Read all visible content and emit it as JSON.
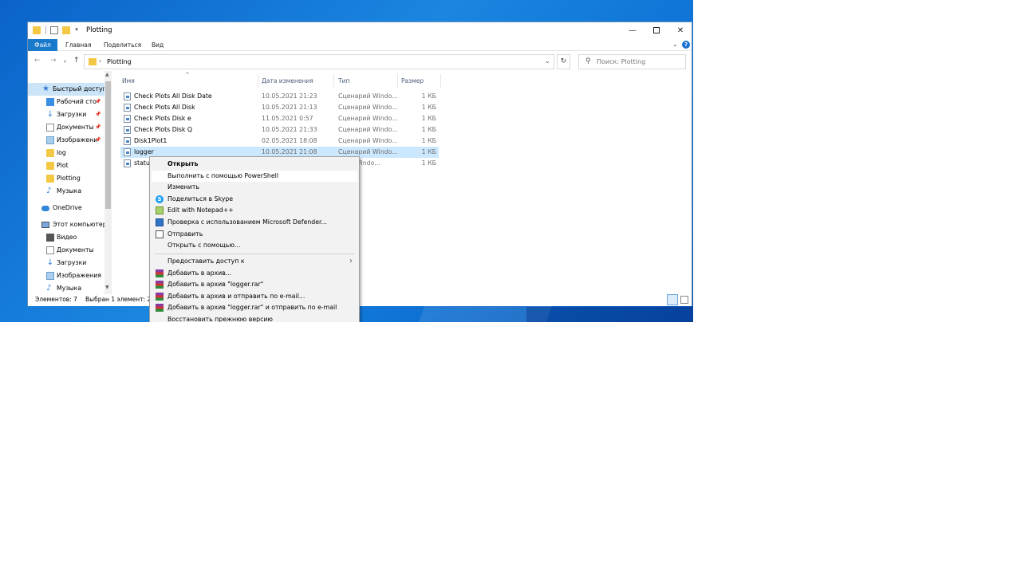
{
  "window": {
    "title": "Plotting",
    "minimize": "—",
    "close": "✕"
  },
  "ribbon": {
    "file": "Файл",
    "home": "Главная",
    "share": "Поделиться",
    "view": "Вид",
    "expand": "⌄",
    "help": "?"
  },
  "address": {
    "path": "Plotting",
    "separator": "›",
    "search_placeholder": "Поиск: Plotting"
  },
  "nav_pane": {
    "items": [
      {
        "label": "Быстрый доступ",
        "icon": "star-icon",
        "pinned": false
      },
      {
        "label": "Рабочий сто",
        "icon": "desktop-icon",
        "pinned": true
      },
      {
        "label": "Загрузки",
        "icon": "downloads-icon",
        "pinned": true
      },
      {
        "label": "Документы",
        "icon": "documents-icon",
        "pinned": true
      },
      {
        "label": "Изображени",
        "icon": "pictures-icon",
        "pinned": true
      },
      {
        "label": "log",
        "icon": "folder-icon",
        "pinned": false
      },
      {
        "label": "Plot",
        "icon": "folder-icon",
        "pinned": false
      },
      {
        "label": "Plotting",
        "icon": "folder-icon",
        "pinned": false
      },
      {
        "label": "Музыка",
        "icon": "music-icon",
        "pinned": false
      },
      {
        "label": "OneDrive",
        "icon": "onedrive-icon",
        "pinned": false
      },
      {
        "label": "Этот компьютер",
        "icon": "computer-icon",
        "pinned": false
      },
      {
        "label": "Видео",
        "icon": "videos-icon",
        "pinned": false
      },
      {
        "label": "Документы",
        "icon": "documents-icon",
        "pinned": false
      },
      {
        "label": "Загрузки",
        "icon": "downloads-icon",
        "pinned": false
      },
      {
        "label": "Изображения",
        "icon": "pictures-icon",
        "pinned": false
      },
      {
        "label": "Музыка",
        "icon": "music-icon",
        "pinned": false
      }
    ]
  },
  "columns": {
    "name": "Имя",
    "date": "Дата изменения",
    "type": "Тип",
    "size": "Размер"
  },
  "files": [
    {
      "name": "Check Plots All Disk Date",
      "date": "10.05.2021 21:23",
      "type": "Сценарий Windo...",
      "size": "1 КБ"
    },
    {
      "name": "Check Plots All Disk",
      "date": "10.05.2021 21:13",
      "type": "Сценарий Windo...",
      "size": "1 КБ"
    },
    {
      "name": "Check Plots Disk e",
      "date": "11.05.2021 0:57",
      "type": "Сценарий Windo...",
      "size": "1 КБ"
    },
    {
      "name": "Check Plots Disk Q",
      "date": "10.05.2021 21:33",
      "type": "Сценарий Windo...",
      "size": "1 КБ"
    },
    {
      "name": "Disk1Plot1",
      "date": "02.05.2021 18:08",
      "type": "Сценарий Windo...",
      "size": "1 КБ"
    },
    {
      "name": "logger",
      "date": "10.05.2021 21:08",
      "type": "Сценарий Windo...",
      "size": "1 КБ"
    },
    {
      "name": "status",
      "date": "",
      "type": "Windo...",
      "size": "1 КБ"
    }
  ],
  "status": {
    "count": "Элементов: 7",
    "selected": "Выбран 1 элемент: 290"
  },
  "context_menu": {
    "items": [
      {
        "label": "Открыть",
        "icon": "",
        "bold": true
      },
      {
        "label": "Выполнить с помощью PowerShell",
        "icon": ""
      },
      {
        "label": "Изменить",
        "icon": ""
      },
      {
        "label": "Поделиться в Skype",
        "icon": "skype-icon"
      },
      {
        "label": "Edit with Notepad++",
        "icon": "notepad-plus-plus-icon"
      },
      {
        "label": "Проверка с использованием Microsoft Defender...",
        "icon": "defender-icon"
      },
      {
        "label": "Отправить",
        "icon": "share-icon"
      },
      {
        "label": "Открыть с помощью...",
        "icon": ""
      },
      {
        "label": "Предоставить доступ к",
        "icon": "",
        "submenu": true
      },
      {
        "label": "Добавить в архив...",
        "icon": "winrar-icon"
      },
      {
        "label": "Добавить в архив \"logger.rar\"",
        "icon": "winrar-icon"
      },
      {
        "label": "Добавить в архив и отправить по e-mail...",
        "icon": "winrar-icon"
      },
      {
        "label": "Добавить в архив \"logger.rar\" и отправить по e-mail",
        "icon": "winrar-icon"
      },
      {
        "label": "Восстановить прежнюю версию",
        "icon": ""
      }
    ]
  }
}
